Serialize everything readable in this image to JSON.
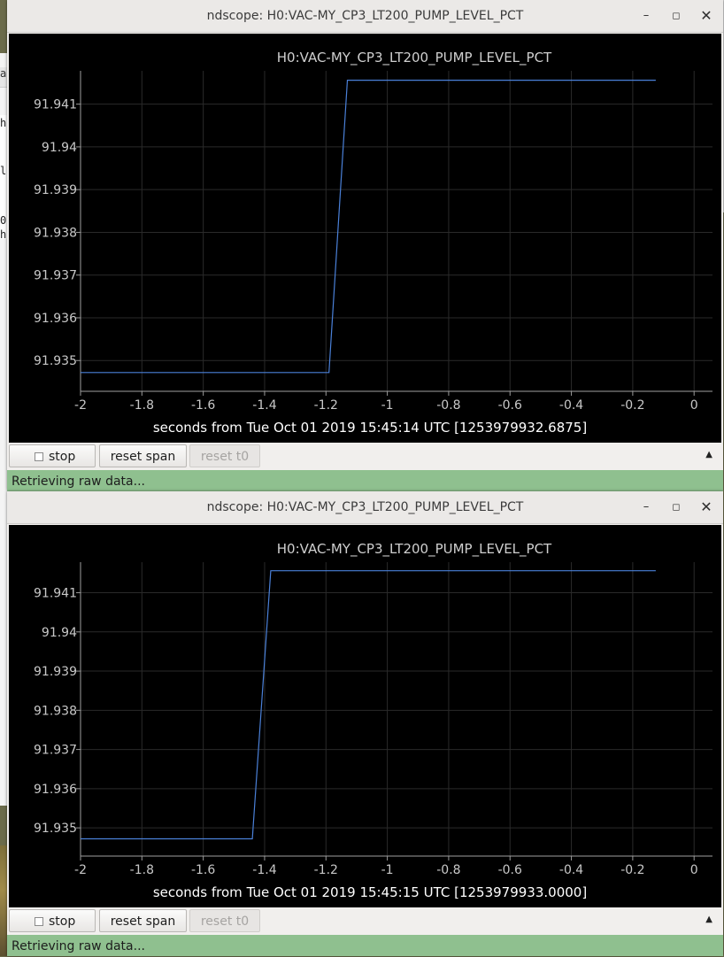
{
  "background": {
    "tab_fragment": "ak",
    "terminal_fragment": [
      "h",
      "l",
      "0",
      "h"
    ]
  },
  "windows": [
    {
      "title": "ndscope: H0:VAC-MY_CP3_LT200_PUMP_LEVEL_PCT",
      "controls": {
        "minimize": "–",
        "maximize": "◻",
        "close": "✕"
      },
      "toolbar": {
        "stop": "stop",
        "reset_span": "reset span",
        "reset_t0": "reset t0",
        "collapse": "▲"
      },
      "status": "Retrieving raw data..."
    },
    {
      "title": "ndscope: H0:VAC-MY_CP3_LT200_PUMP_LEVEL_PCT",
      "controls": {
        "minimize": "–",
        "maximize": "◻",
        "close": "✕"
      },
      "toolbar": {
        "stop": "stop",
        "reset_span": "reset span",
        "reset_t0": "reset t0",
        "collapse": "▲"
      },
      "status": "Retrieving raw data..."
    }
  ],
  "colors": {
    "trace": "#4a80d8",
    "plot_bg": "#000000",
    "axis_text": "#c8c8c8",
    "status_bar": "#8fc08f"
  },
  "chart_data": [
    {
      "type": "line",
      "title": "H0:VAC-MY_CP3_LT200_PUMP_LEVEL_PCT",
      "xlabel": "seconds from Tue Oct 01 2019 15:45:14 UTC [1253979932.6875]",
      "ylabel": "",
      "xlim": [
        -2,
        0.06
      ],
      "ylim": [
        91.93428,
        91.94178
      ],
      "x_ticks": [
        "-2",
        "-1.8",
        "-1.6",
        "-1.4",
        "-1.2",
        "-1",
        "-0.8",
        "-0.6",
        "-0.4",
        "-0.2",
        "0"
      ],
      "y_ticks": [
        "91.935",
        "91.936",
        "91.937",
        "91.938",
        "91.939",
        "91.94",
        "91.941"
      ],
      "grid": true,
      "series": [
        {
          "x": [
            -2,
            -1.19,
            -1.13,
            -0.125
          ],
          "y": [
            91.93472,
            91.93472,
            91.94156,
            91.94156
          ]
        }
      ]
    },
    {
      "type": "line",
      "title": "H0:VAC-MY_CP3_LT200_PUMP_LEVEL_PCT",
      "xlabel": "seconds from Tue Oct 01 2019 15:45:15 UTC [1253979933.0000]",
      "ylabel": "",
      "xlim": [
        -2,
        0.06
      ],
      "ylim": [
        91.93428,
        91.94178
      ],
      "x_ticks": [
        "-2",
        "-1.8",
        "-1.6",
        "-1.4",
        "-1.2",
        "-1",
        "-0.8",
        "-0.6",
        "-0.4",
        "-0.2",
        "0"
      ],
      "y_ticks": [
        "91.935",
        "91.936",
        "91.937",
        "91.938",
        "91.939",
        "91.94",
        "91.941"
      ],
      "grid": true,
      "series": [
        {
          "x": [
            -2,
            -1.44,
            -1.38,
            -0.125
          ],
          "y": [
            91.93472,
            91.93472,
            91.94156,
            91.94156
          ]
        }
      ]
    }
  ]
}
